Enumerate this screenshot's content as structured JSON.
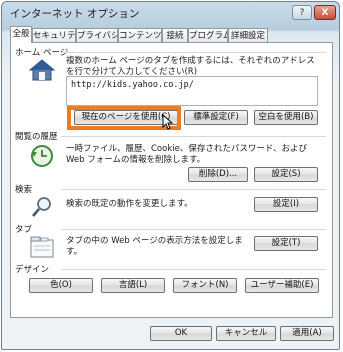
{
  "window": {
    "title": "インターネット オプション",
    "help": "?",
    "close": "X"
  },
  "tabs": [
    "全般",
    "セキュリティ",
    "プライバシー",
    "コンテンツ",
    "接続",
    "プログラム",
    "詳細設定"
  ],
  "home": {
    "section": "ホーム ページ",
    "description": "複数のホーム ページのタブを作成するには、それぞれのアドレスを行で分けて入力してください(R)",
    "url": "http://kids.yahoo.co.jp/",
    "buttons": {
      "use_current": "現在のページを使用(C)",
      "use_default": "標準設定(F)",
      "use_blank": "空白を使用(B)"
    }
  },
  "history": {
    "section": "閲覧の履歴",
    "description": "一時ファイル、履歴、Cookie、保存されたパスワード、および Web フォームの情報を削除します。",
    "buttons": {
      "delete": "削除(D)...",
      "settings": "設定(S)"
    }
  },
  "search": {
    "section": "検索",
    "description": "検索の既定の動作を変更します。",
    "buttons": {
      "settings": "設定(I)"
    }
  },
  "tabs_section": {
    "section": "タブ",
    "description": "タブの中の Web ページの表示方法を設定します。",
    "buttons": {
      "settings": "設定(T)"
    }
  },
  "design": {
    "section": "デザイン",
    "buttons": {
      "colors": "色(O)",
      "languages": "言語(L)",
      "fonts": "フォント(N)",
      "accessibility": "ユーザー補助(E)"
    }
  },
  "footer": {
    "ok": "OK",
    "cancel": "キャンセル",
    "apply": "適用(A)"
  },
  "colors": {
    "highlight": "#f07a1e"
  }
}
